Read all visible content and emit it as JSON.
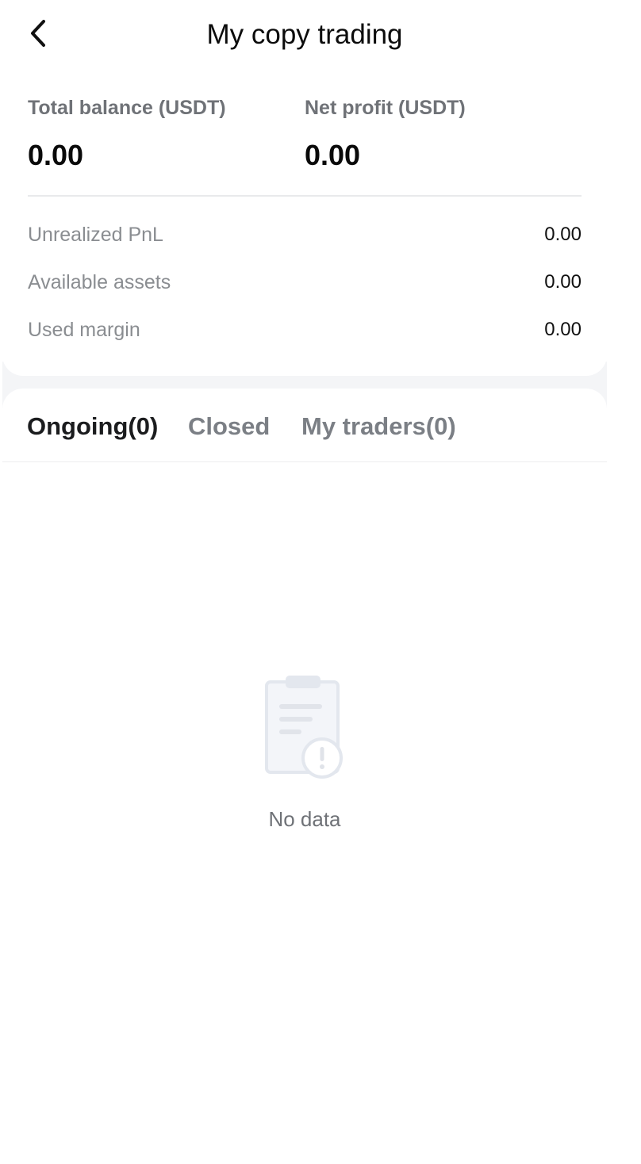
{
  "header": {
    "title": "My copy trading",
    "back_icon": "chevron-left-icon"
  },
  "summary": {
    "total_balance_label": "Total balance (USDT)",
    "total_balance_value": "0.00",
    "net_profit_label": "Net profit (USDT)",
    "net_profit_value": "0.00",
    "rows": [
      {
        "label": "Unrealized PnL",
        "value": "0.00"
      },
      {
        "label": "Available assets",
        "value": "0.00"
      },
      {
        "label": "Used margin",
        "value": "0.00"
      }
    ]
  },
  "tabs": [
    {
      "label": "Ongoing(0)",
      "active": true
    },
    {
      "label": "Closed",
      "active": false
    },
    {
      "label": "My traders(0)",
      "active": false
    }
  ],
  "empty_state": {
    "icon": "empty-clipboard-alert-icon",
    "text": "No data"
  },
  "colors": {
    "background": "#ffffff",
    "band": "#f4f5f7",
    "label_gray": "#6f7277",
    "text_dark": "#111111"
  }
}
